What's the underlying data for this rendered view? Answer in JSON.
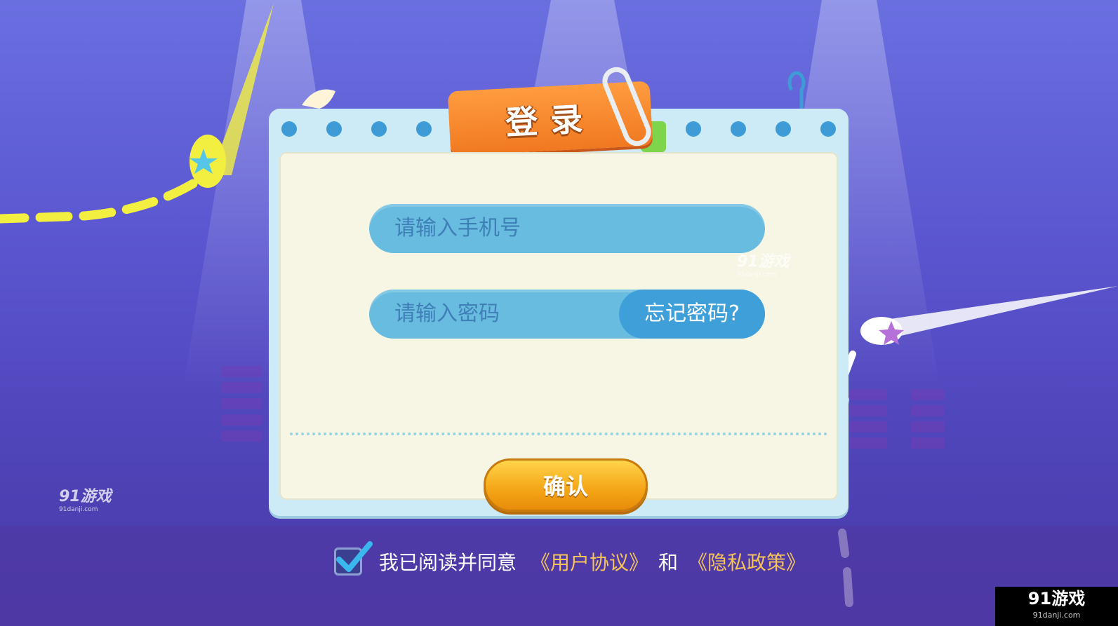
{
  "dialog": {
    "title": "登录",
    "phone_placeholder": "请输入手机号",
    "password_placeholder": "请输入密码",
    "forgot_password": "忘记密码?",
    "confirm_button": "确认"
  },
  "agreement": {
    "text": "我已阅读并同意",
    "user_agreement": "《用户协议》",
    "and": "和",
    "privacy_policy": "《隐私政策》",
    "checked": true
  },
  "watermarks": {
    "brand": "91游戏",
    "domain": "91danji.com"
  },
  "colors": {
    "background": "#5a55cf",
    "tab_orange": "#f07820",
    "field_blue": "#68bce0",
    "confirm_yellow": "#f4a516",
    "link_gold": "#f5c35a"
  }
}
